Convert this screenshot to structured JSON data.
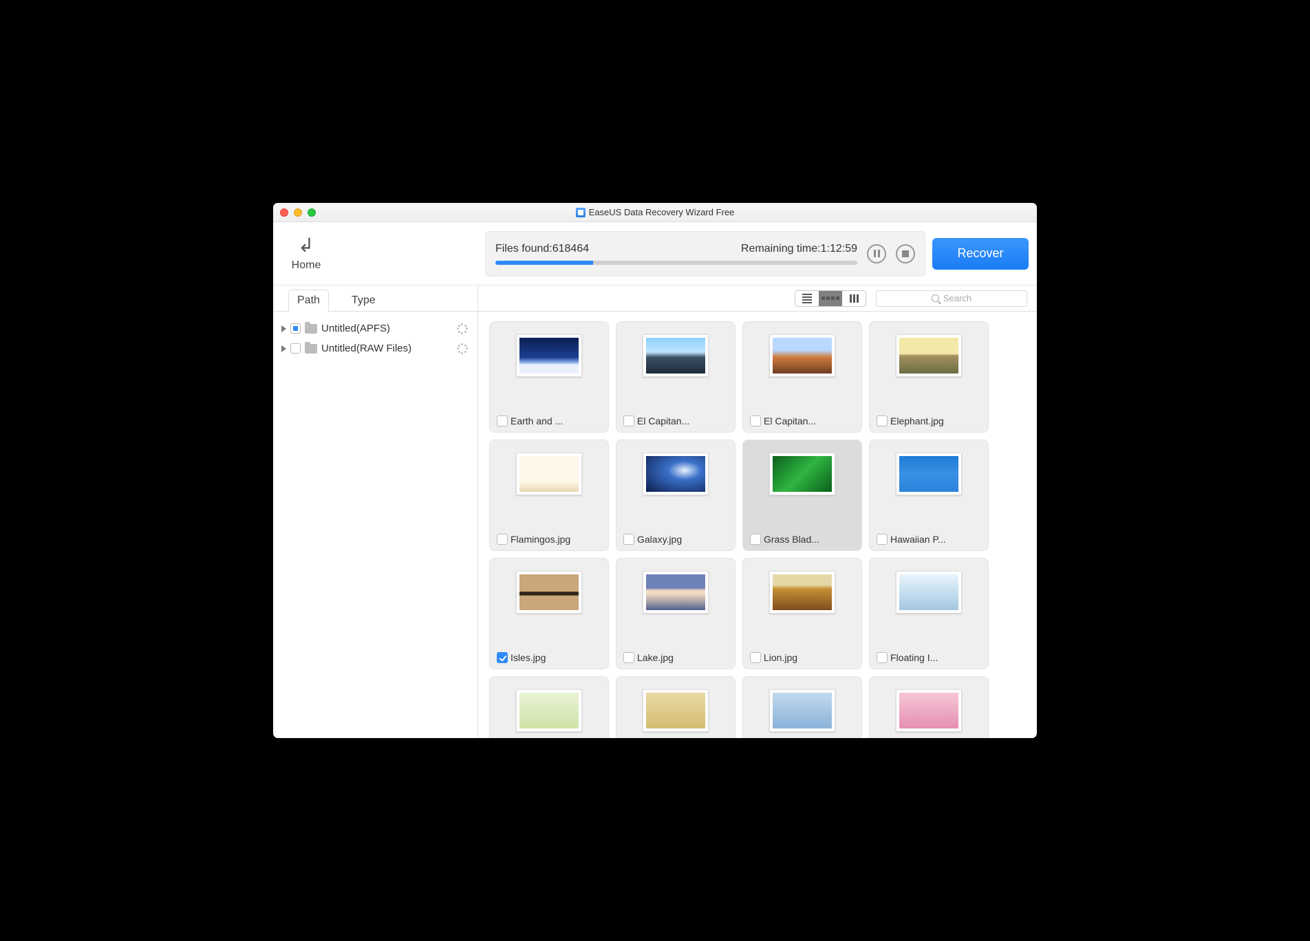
{
  "window": {
    "title": "EaseUS Data Recovery Wizard Free"
  },
  "home": {
    "label": "Home"
  },
  "scan": {
    "files_label": "Files found:",
    "files_count": "618464",
    "remaining_label": "Remaining time:",
    "remaining_value": "1:12:59",
    "progress_pct": 27
  },
  "actions": {
    "recover_label": "Recover"
  },
  "tabs": {
    "path": "Path",
    "type": "Type",
    "active": "path"
  },
  "tree": [
    {
      "name": "Untitled(APFS)",
      "indeterminate": true,
      "loading": true
    },
    {
      "name": "Untitled(RAW Files)",
      "indeterminate": false,
      "loading": true
    }
  ],
  "search": {
    "placeholder": "Search"
  },
  "view_mode": "grid",
  "files": [
    {
      "label": "Earth and ...",
      "checked": false,
      "thumb": "th-earth"
    },
    {
      "label": "El Capitan...",
      "checked": false,
      "thumb": "th-cap1"
    },
    {
      "label": "El Capitan...",
      "checked": false,
      "thumb": "th-cap2"
    },
    {
      "label": "Elephant.jpg",
      "checked": false,
      "thumb": "th-eleph"
    },
    {
      "label": "Flamingos.jpg",
      "checked": false,
      "thumb": "th-flam"
    },
    {
      "label": "Galaxy.jpg",
      "checked": false,
      "thumb": "th-gal"
    },
    {
      "label": "Grass Blad...",
      "checked": false,
      "thumb": "th-grass",
      "selected": true
    },
    {
      "label": "Hawaiian P...",
      "checked": false,
      "thumb": "th-haw"
    },
    {
      "label": "Isles.jpg",
      "checked": true,
      "thumb": "th-isles"
    },
    {
      "label": "Lake.jpg",
      "checked": false,
      "thumb": "th-lake"
    },
    {
      "label": "Lion.jpg",
      "checked": false,
      "thumb": "th-lion"
    },
    {
      "label": "Floating I...",
      "checked": false,
      "thumb": "th-float"
    },
    {
      "label": "",
      "checked": false,
      "thumb": "th-extra1",
      "partial": true
    },
    {
      "label": "",
      "checked": false,
      "thumb": "th-extra2",
      "partial": true
    },
    {
      "label": "",
      "checked": false,
      "thumb": "th-extra4",
      "partial": true
    },
    {
      "label": "",
      "checked": false,
      "thumb": "th-extra3",
      "partial": true
    }
  ]
}
